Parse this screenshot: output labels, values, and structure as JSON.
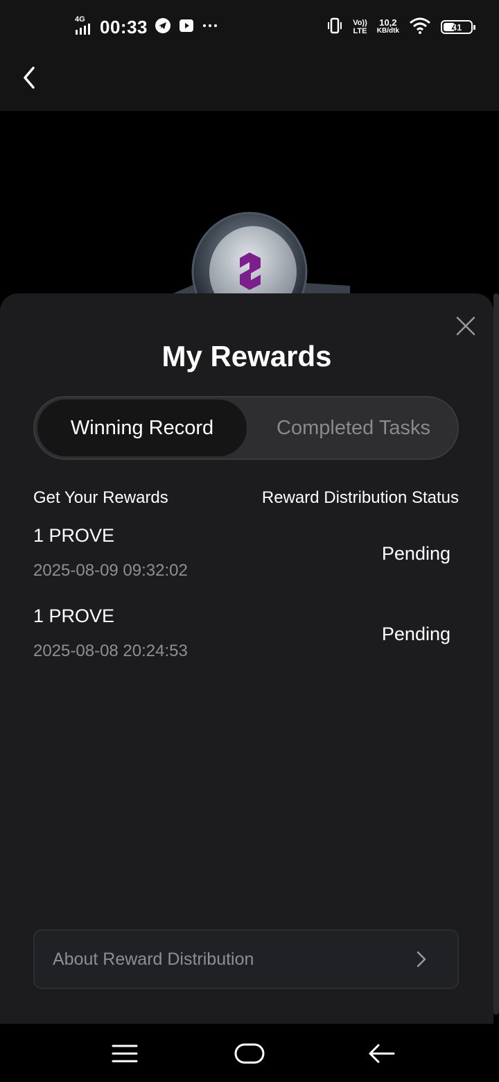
{
  "status_bar": {
    "network": "4G",
    "time": "00:33",
    "volte_label": "Vo))",
    "lte_label": "LTE",
    "speed_value": "10,2",
    "speed_unit": "KB/dtk",
    "battery": "41",
    "battery_level_percent": 41
  },
  "header": {
    "back_icon": "chevron-left-icon"
  },
  "sheet": {
    "title": "My Rewards",
    "close_icon": "close-icon",
    "tabs": [
      {
        "label": "Winning Record",
        "active": true
      },
      {
        "label": "Completed Tasks",
        "active": false
      }
    ],
    "columns": {
      "left": "Get Your Rewards",
      "right": "Reward Distribution Status"
    },
    "rewards": [
      {
        "amount": "1 PROVE",
        "date": "2025-08-09 09:32:02",
        "status": "Pending"
      },
      {
        "amount": "1 PROVE",
        "date": "2025-08-08 20:24:53",
        "status": "Pending"
      }
    ],
    "about": {
      "label": "About Reward Distribution",
      "icon": "chevron-right-icon"
    }
  },
  "nav_bar": {
    "icons": [
      "menu-icon",
      "home-icon",
      "back-arrow-icon"
    ]
  },
  "colors": {
    "background": "#000000",
    "sheet": "#1c1c1e",
    "muted_text": "#8e8e93",
    "logo_accent": "#7a1f8c"
  }
}
